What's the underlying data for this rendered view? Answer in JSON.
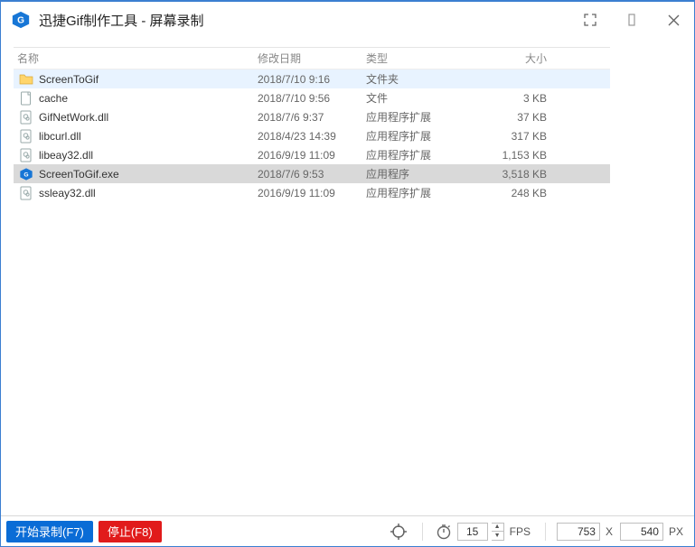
{
  "titlebar": {
    "title": "迅捷Gif制作工具 - 屏幕录制"
  },
  "columns": {
    "name": "名称",
    "date": "修改日期",
    "type": "类型",
    "size": "大小"
  },
  "files": [
    {
      "icon": "folder",
      "name": "ScreenToGif",
      "date": "2018/7/10 9:16",
      "type": "文件夹",
      "size": "",
      "state": "hovered"
    },
    {
      "icon": "file",
      "name": "cache",
      "date": "2018/7/10 9:56",
      "type": "文件",
      "size": "3 KB",
      "state": ""
    },
    {
      "icon": "dll",
      "name": "GifNetWork.dll",
      "date": "2018/7/6 9:37",
      "type": "应用程序扩展",
      "size": "37 KB",
      "state": ""
    },
    {
      "icon": "dll",
      "name": "libcurl.dll",
      "date": "2018/4/23 14:39",
      "type": "应用程序扩展",
      "size": "317 KB",
      "state": ""
    },
    {
      "icon": "dll",
      "name": "libeay32.dll",
      "date": "2016/9/19 11:09",
      "type": "应用程序扩展",
      "size": "1,153 KB",
      "state": ""
    },
    {
      "icon": "exe",
      "name": "ScreenToGif.exe",
      "date": "2018/7/6 9:53",
      "type": "应用程序",
      "size": "3,518 KB",
      "state": "selected"
    },
    {
      "icon": "dll",
      "name": "ssleay32.dll",
      "date": "2016/9/19 11:09",
      "type": "应用程序扩展",
      "size": "248 KB",
      "state": ""
    }
  ],
  "footer": {
    "start_label": "开始录制(F7)",
    "stop_label": "停止(F8)",
    "fps_value": "15",
    "fps_unit": "FPS",
    "width_value": "753",
    "sep_x": "X",
    "height_value": "540",
    "px_unit": "PX"
  }
}
